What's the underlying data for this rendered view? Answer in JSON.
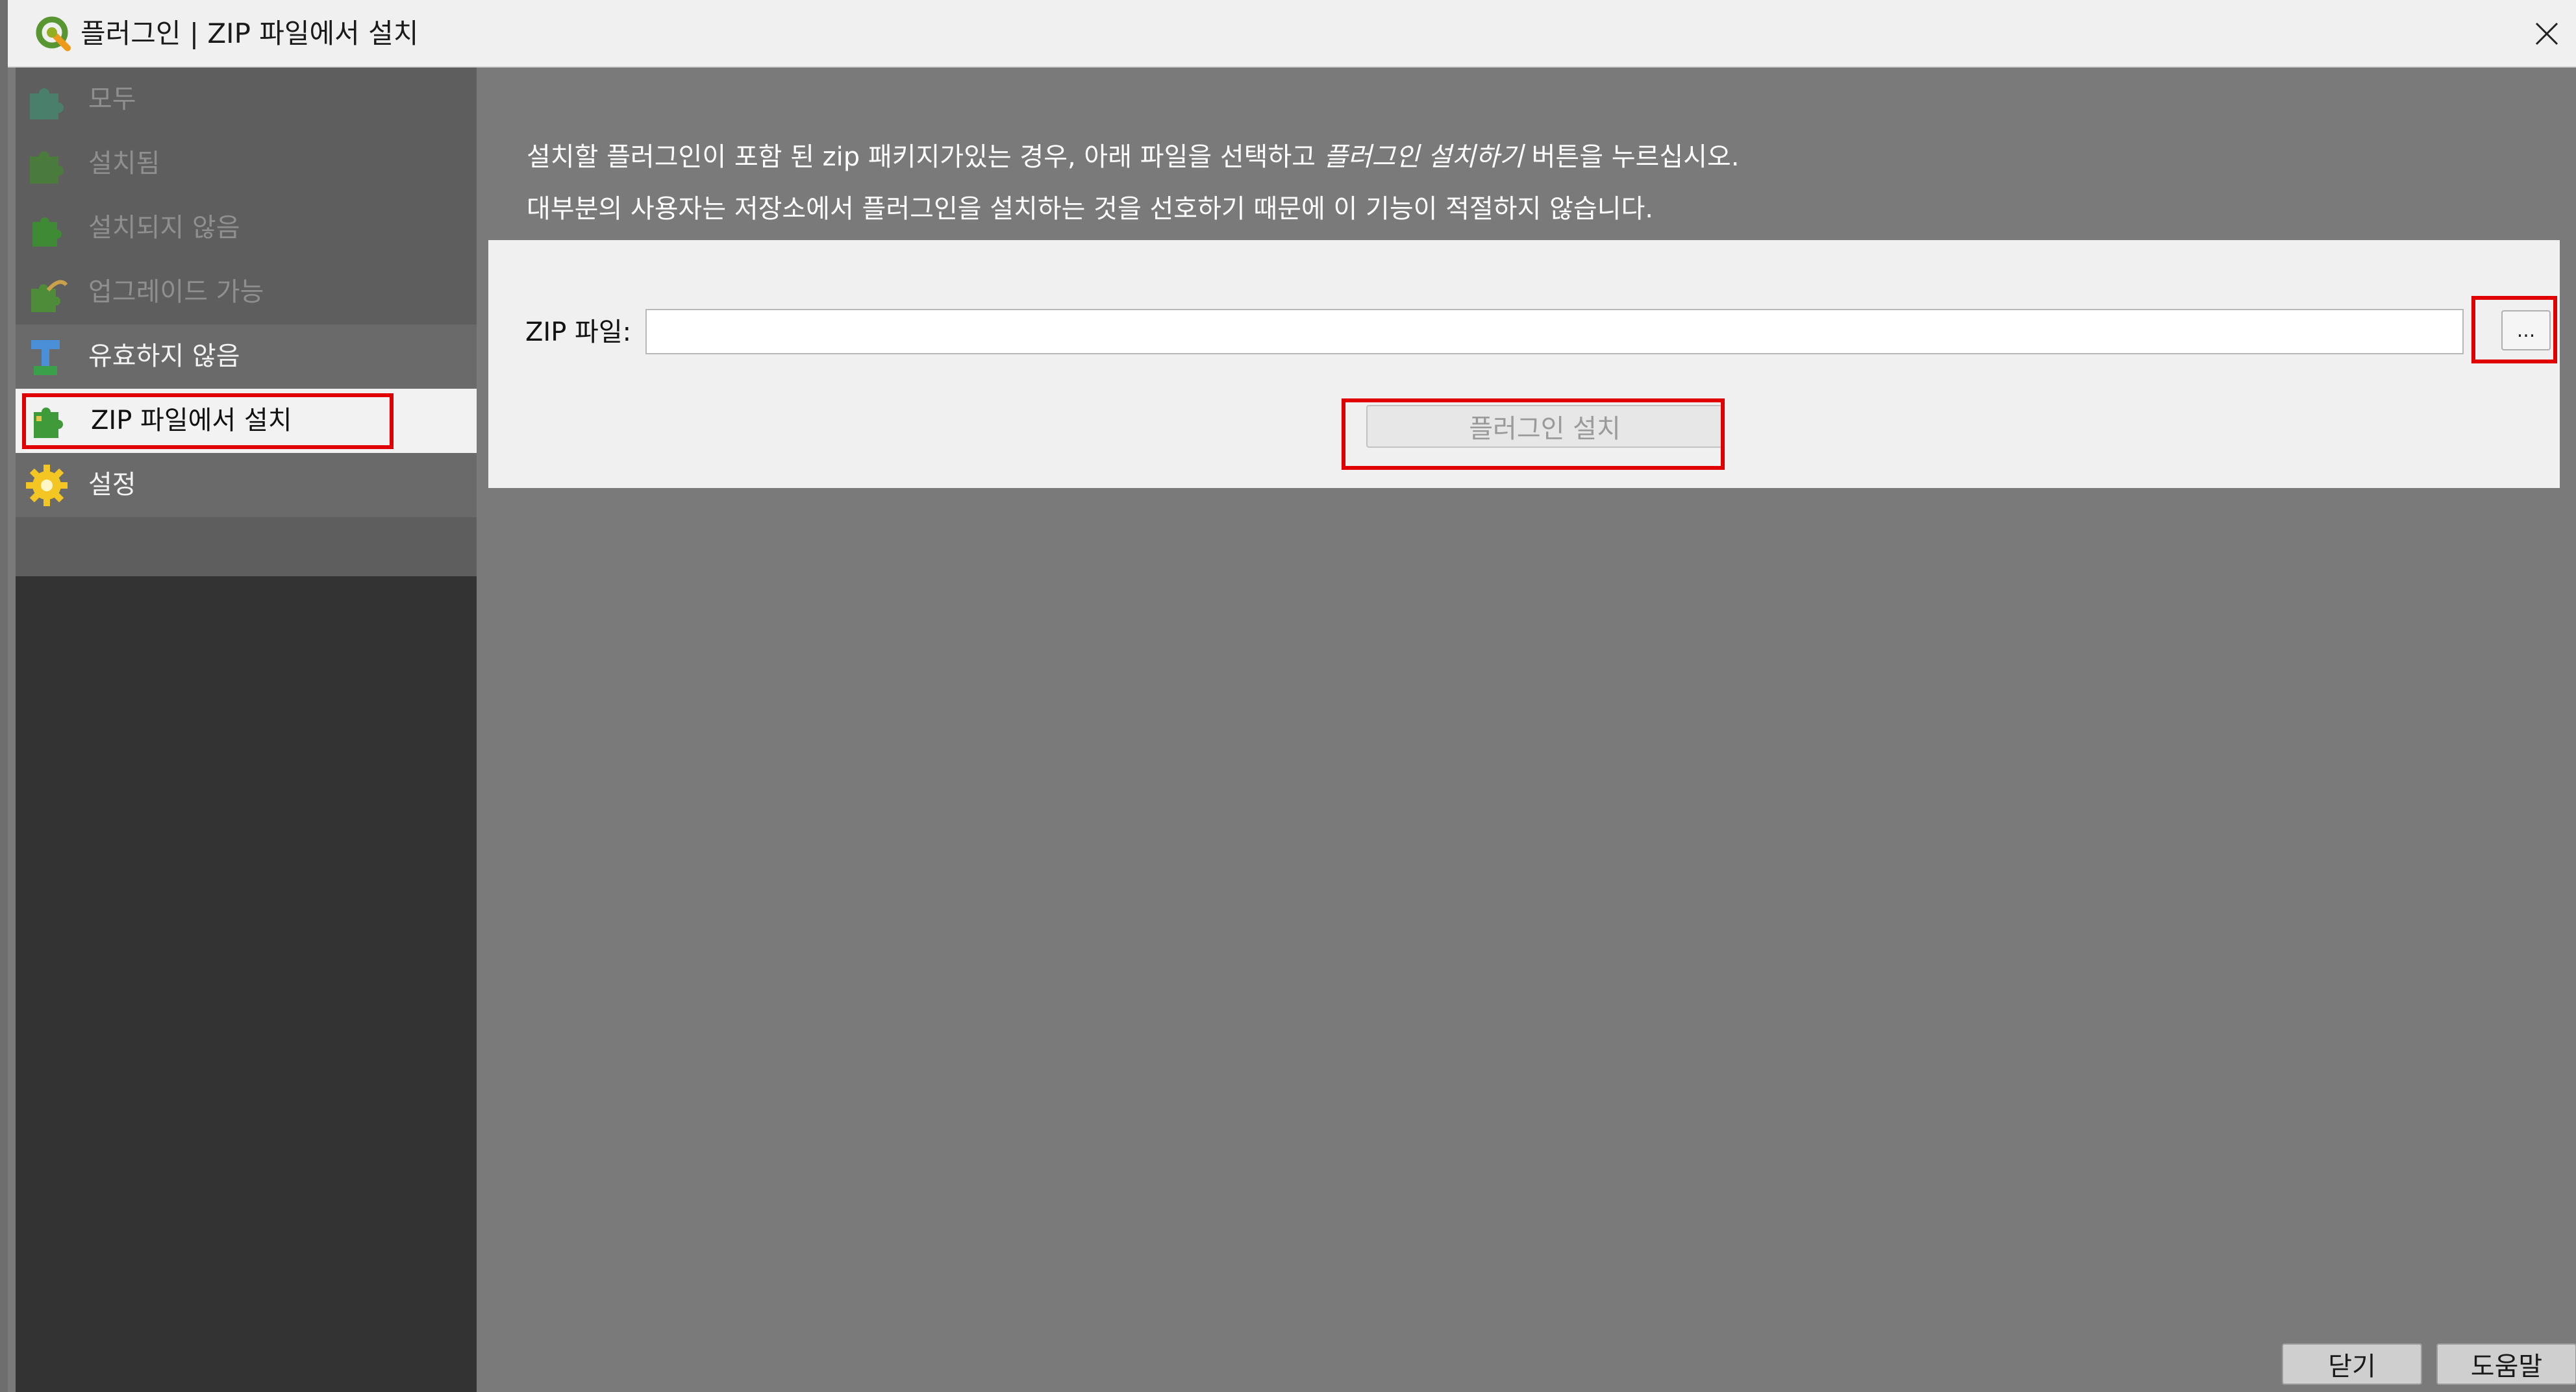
{
  "window": {
    "title": "플러그인 | ZIP 파일에서 설치",
    "app_icon": "qgis-logo-icon",
    "close_icon": "close-icon"
  },
  "sidebar": {
    "items": [
      {
        "label": "모두",
        "icon": "puzzle-blue-icon",
        "state": "dim"
      },
      {
        "label": "설치됨",
        "icon": "puzzle-green-icon",
        "state": "dim"
      },
      {
        "label": "설치되지 않음",
        "icon": "puzzle-green-icon",
        "state": "dim"
      },
      {
        "label": "업그레이드 가능",
        "icon": "puzzle-upgrade-icon",
        "state": "dim"
      },
      {
        "label": "유효하지 않음",
        "icon": "invalid-plugin-icon",
        "state": "normal"
      },
      {
        "label": "ZIP 파일에서 설치",
        "icon": "zip-install-icon",
        "state": "selected"
      },
      {
        "label": "설정",
        "icon": "gear-icon",
        "state": "normal"
      }
    ]
  },
  "main": {
    "info_line1_part1": "설치할 플러그인이 포함 된 zip 패키지가있는 경우, 아래 파일을 선택하고 ",
    "info_line1_italic": "플러그인 설치하기",
    "info_line1_part2": " 버튼을 누르십시오.",
    "info_line2": "대부분의 사용자는 저장소에서 플러그인을 설치하는 것을 선호하기 때문에 이 기능이 적절하지 않습니다.",
    "zip_label": "ZIP 파일:",
    "zip_value": "",
    "zip_placeholder": "",
    "browse_label": "...",
    "install_label": "플러그인 설치"
  },
  "footer": {
    "close_label": "닫기",
    "help_label": "도움말"
  },
  "colors": {
    "highlight": "#e00000",
    "sidebar_bg": "#333333",
    "selected_bg": "#f2f2f2"
  }
}
